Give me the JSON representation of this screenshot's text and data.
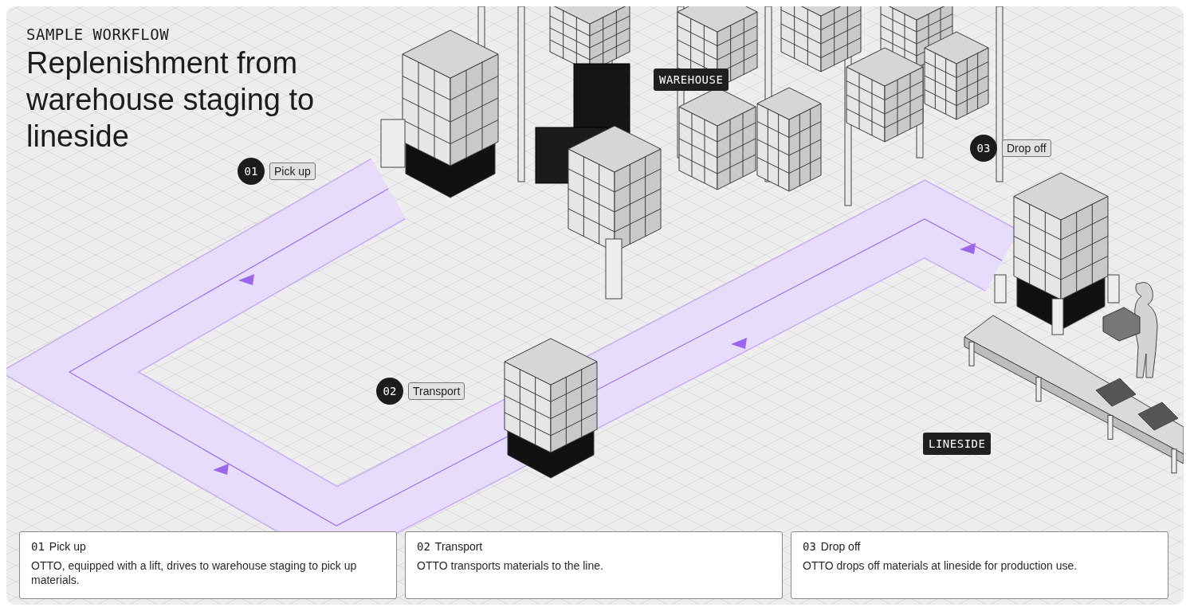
{
  "header": {
    "eyebrow": "SAMPLE WORKFLOW",
    "title": "Replenishment from warehouse staging to lineside"
  },
  "markers": [
    {
      "number": "01",
      "label": "Pick up"
    },
    {
      "number": "02",
      "label": "Transport"
    },
    {
      "number": "03",
      "label": "Drop off"
    }
  ],
  "zones": [
    {
      "label": "WAREHOUSE"
    },
    {
      "label": "LINESIDE"
    }
  ],
  "steps": [
    {
      "number": "01",
      "title": "Pick up",
      "description": "OTTO, equipped with a lift, drives to warehouse staging to pick up materials."
    },
    {
      "number": "02",
      "title": "Transport",
      "description": "OTTO transports materials to the line."
    },
    {
      "number": "03",
      "title": "Drop off",
      "description": "OTTO drops off materials at lineside for production use."
    }
  ]
}
